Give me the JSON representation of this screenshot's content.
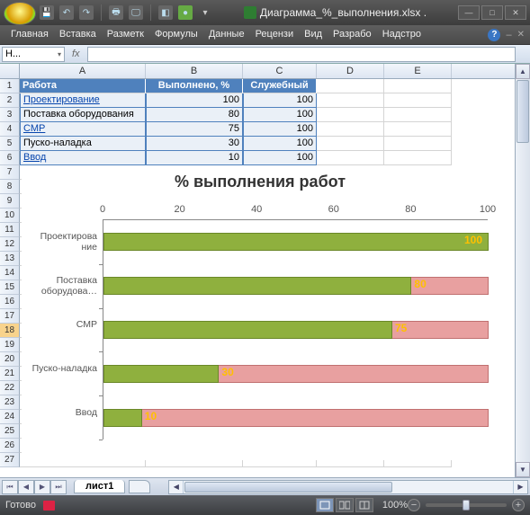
{
  "window": {
    "title": "Диаграмма_%_выполнения.xlsx ."
  },
  "ribbon": {
    "tabs": [
      "Главная",
      "Вставка",
      "Разметк",
      "Формулы",
      "Данные",
      "Рецензи",
      "Вид",
      "Разрабо",
      "Надстро"
    ]
  },
  "formula_bar": {
    "name_box": "Н...",
    "fx": "fx"
  },
  "columns": [
    "A",
    "B",
    "C",
    "D",
    "E"
  ],
  "table": {
    "headers": {
      "work": "Работа",
      "done": "Выполнено, %",
      "service": "Служебный"
    },
    "rows": [
      {
        "work": "Проектирование",
        "done": 100,
        "service": 100,
        "link": true
      },
      {
        "work": "Поставка оборудования",
        "done": 80,
        "service": 100
      },
      {
        "work": "СМР",
        "done": 75,
        "service": 100,
        "link": true
      },
      {
        "work": "Пуско-наладка",
        "done": 30,
        "service": 100
      },
      {
        "work": "Ввод",
        "done": 10,
        "service": 100,
        "link": true
      }
    ]
  },
  "chart_data": {
    "type": "bar",
    "title": "% выполнения работ",
    "orientation": "horizontal",
    "xlim": [
      0,
      100
    ],
    "x_ticks": [
      0,
      20,
      40,
      60,
      80,
      100
    ],
    "categories": [
      "Проектирова\nние",
      "Поставка оборудова…",
      "СМР",
      "Пуско-наладка",
      "Ввод"
    ],
    "series": [
      {
        "name": "Служебный",
        "values": [
          100,
          100,
          100,
          100,
          100
        ],
        "color": "#e8a0a0"
      },
      {
        "name": "Выполнено, %",
        "values": [
          100,
          80,
          75,
          30,
          10
        ],
        "color": "#8fb03e"
      }
    ],
    "data_labels": [
      100,
      80,
      75,
      30,
      10
    ]
  },
  "sheet_tabs": {
    "active": "лист1"
  },
  "status": {
    "ready": "Готово",
    "zoom": "100%"
  },
  "selected_row": 18
}
